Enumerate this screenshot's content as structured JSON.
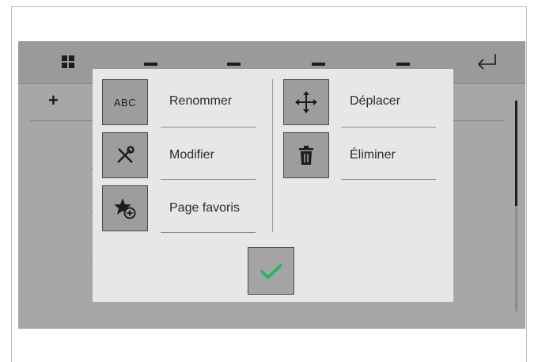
{
  "header": {
    "grid_icon": "grid-icon",
    "back_icon": "return-arrow-icon"
  },
  "list": {
    "add_symbol": "+"
  },
  "dialog": {
    "actions_left": [
      {
        "icon_text": "ABC",
        "icon": "abc-text-icon",
        "label": "Renommer"
      },
      {
        "icon": "wrench-screwdriver-icon",
        "label": "Modifier"
      },
      {
        "icon": "star-plus-icon",
        "label": "Page favoris"
      }
    ],
    "actions_right": [
      {
        "icon": "move-arrows-icon",
        "label": "Déplacer"
      },
      {
        "icon": "trash-icon",
        "label": "Éliminer"
      }
    ],
    "confirm_icon": "checkmark-icon",
    "accent_color": "#1db954"
  }
}
